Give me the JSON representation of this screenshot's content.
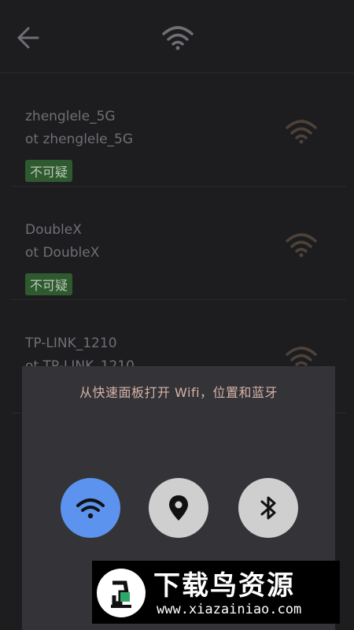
{
  "header": {
    "back_icon": "arrow-left-icon",
    "wifi_icon": "wifi-icon"
  },
  "networks": [
    {
      "ssid": "zhenglele_5G",
      "ssid_secondary": "ot zhenglele_5G",
      "badge": "不可疑"
    },
    {
      "ssid": "DoubleX",
      "ssid_secondary": "ot DoubleX",
      "badge": "不可疑"
    },
    {
      "ssid": "TP-LINK_1210",
      "ssid_secondary": "ot TP-LINK_1210",
      "badge": ""
    }
  ],
  "quick_panel": {
    "title": "从快速面板打开 Wifi，位置和蓝牙",
    "toggles": [
      {
        "name": "wifi",
        "icon": "wifi-icon",
        "state": "on",
        "color": "#5b93ef"
      },
      {
        "name": "location",
        "icon": "location-pin-icon",
        "state": "off",
        "color": "#cfcfcf"
      },
      {
        "name": "bluetooth",
        "icon": "bluetooth-icon",
        "state": "off",
        "color": "#cfcfcf"
      }
    ]
  },
  "watermark": {
    "brand": "下载鸟资源",
    "url": "www.xiazainiao.com"
  }
}
